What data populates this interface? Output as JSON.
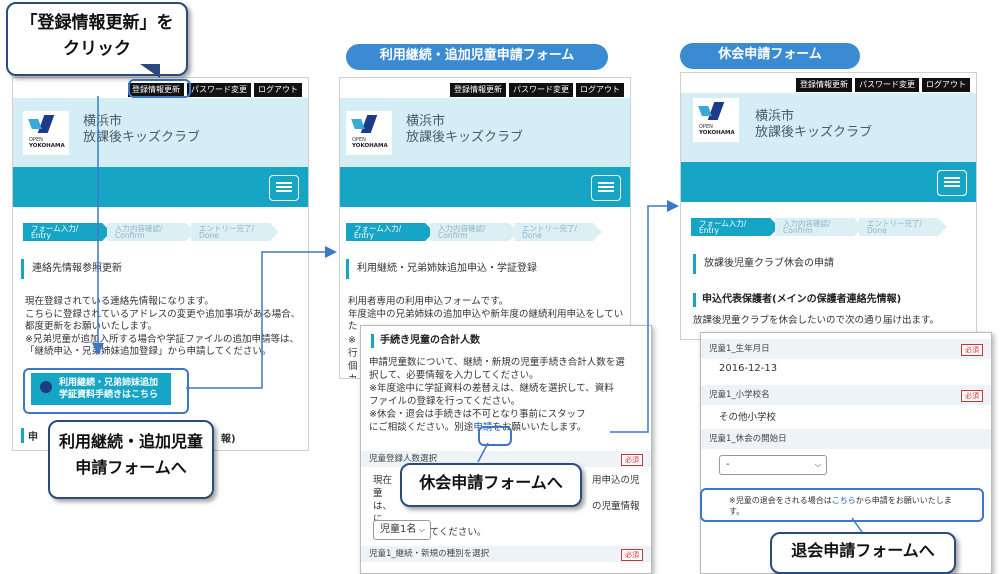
{
  "top_buttons": [
    "登録情報更新",
    "パスワード変更",
    "ログアウト"
  ],
  "site": {
    "org_line1": "横浜市",
    "org_line2": "放課後キッズクラブ",
    "logo_line1": "OPEN",
    "logo_line2": "YOKOHAMA"
  },
  "steps": [
    {
      "line1": "フォーム入力/",
      "line2": "Entry"
    },
    {
      "line1": "入力内容確認/",
      "line2": "Confirm"
    },
    {
      "line1": "エントリー完了/",
      "line2": "Done"
    }
  ],
  "callouts": {
    "click_update_line1": "「登録情報更新」を",
    "click_update_line2": "クリック",
    "to_sibling_form_line1": "利用継続・追加児童",
    "to_sibling_form_line2": "申請フォームへ",
    "to_absence_form": "休会申請フォームへ",
    "to_withdraw_form": "退会申請フォームへ"
  },
  "titles": {
    "sibling_form": "利用継続・追加児童申請フォーム",
    "absence_form": "休会申請フォーム"
  },
  "panel1": {
    "section": "連絡先情報参照更新",
    "para": [
      "現在登録されている連絡先情報になります。",
      "こちらに登録されているアドレスの変更や追加事項がある場合、",
      "都度更新をお願いいたします。",
      "※兄弟児童が追加入所する場合や学証ファイルの追加申請等は、",
      "「継続申込・兄弟姉妹追加登録」から申請してください。"
    ],
    "button_line1": "利用継続・兄弟姉妹追加",
    "button_line2": "学証資料手続きはこちら",
    "bottom_fragment_left": "申",
    "bottom_fragment_right": "報)"
  },
  "panel2": {
    "section": "利用継続・兄弟姉妹追加申込・学証登録",
    "para": [
      "利用者専用の利用申込フォームです。",
      "年度途中の兄弟姉妹の追加申込や新年度の継続利用申込をしてい",
      "た"
    ],
    "side_chars": [
      "※",
      "行",
      "個",
      "カ"
    ],
    "popup_title": "手続き児童の合計人数",
    "popup_para": [
      "申請児童数について、継続・新規の児童手続き合計人数を選",
      "択して、必要情報を入力してください。",
      "※年度途中に学証資料の差替えは、継続を選択して、資料",
      "ファイルの登録を行ってください。",
      "※休会・退会は手続きは不可となり事前にスタッフ"
    ],
    "popup_link_prefix": "にご相談ください。別途",
    "popup_link": "申請",
    "popup_link_suffix": "をお願いいたします。",
    "row1_label": "児童登録人数選択",
    "required": "必須",
    "bg_line1_left": "現在",
    "bg_line1_right": "用申込の児童",
    "bg_line2_left": "は、",
    "bg_line2_right": "の児童情報に",
    "bg_line3": "新規申込をしてください。",
    "select_value": "児童1名",
    "row2_label": "児童1_継続・新規の種別を選択"
  },
  "panel3": {
    "section": "放課後児童クラブ休会の申請",
    "sub_section": "申込代表保護者(メインの保護者連絡先情報)",
    "cut_text": "放課後児童クラブを休会したいので次の通り届け出ます。",
    "row1_label": "児童1_生年月日",
    "row1_value": "2016-12-13",
    "row2_label": "児童1_小学校名",
    "row2_value": "その他小学校",
    "row3_label": "児童1_休会の開始日",
    "select_value": "-",
    "required": "必須",
    "note_prefix": "※児童の退会をされる場合は",
    "note_link": "こちら",
    "note_suffix": "から申請をお願いいたしま",
    "note_line2": "す。"
  },
  "colors": {
    "accent": "#17a5c6",
    "header_bg": "#d5eef6",
    "callout_border": "#2b4a7e",
    "pill": "#3a8bd2"
  }
}
